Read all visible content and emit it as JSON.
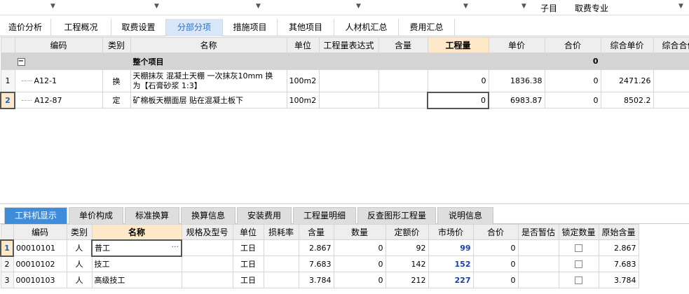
{
  "top_bar": {
    "labels": [
      "子目",
      "取费专业"
    ]
  },
  "main_tabs": [
    "造价分析",
    "工程概况",
    "取费设置",
    "分部分项",
    "措施项目",
    "其他项目",
    "人材机汇总",
    "费用汇总"
  ],
  "upper_table": {
    "columns": [
      "编码",
      "类别",
      "名称",
      "单位",
      "工程量表达式",
      "含量",
      "工程量",
      "单价",
      "合价",
      "综合单价",
      "综合合价"
    ],
    "group_row": {
      "name": "整个项目",
      "total": "0"
    },
    "rows": [
      {
        "row_num": "1",
        "code": "A12-1",
        "type": "换",
        "name_line1": "天棚抹灰 混凝土天棚 一次抹灰10mm  换",
        "name_line2": "为【石膏砂浆 1:3】",
        "unit": "100m2",
        "expr": "",
        "content": "",
        "quantity": "0",
        "unit_price": "1836.38",
        "total": "0",
        "comp_price": "2471.26"
      },
      {
        "row_num": "2",
        "code": "A12-87",
        "type": "定",
        "name_line1": "矿棉板天棚面层 贴在混凝土板下",
        "unit": "100m2",
        "expr": "",
        "content": "",
        "quantity": "0",
        "unit_price": "6983.87",
        "total": "0",
        "comp_price": "8502.2"
      }
    ]
  },
  "bottom_tabs": [
    "工料机显示",
    "单价构成",
    "标准换算",
    "换算信息",
    "安装费用",
    "工程量明细",
    "反查图形工程量",
    "说明信息"
  ],
  "lower_table": {
    "columns": [
      "编码",
      "类别",
      "名称",
      "规格及型号",
      "单位",
      "损耗率",
      "含量",
      "数量",
      "定额价",
      "市场价",
      "合价",
      "是否暂估",
      "锁定数量",
      "原始含量"
    ],
    "rows": [
      {
        "row_num": "1",
        "code": "00010101",
        "type": "人",
        "name": "普工",
        "unit": "工日",
        "content": "2.867",
        "qty": "0",
        "fixed_price": "92",
        "market_price": "99",
        "total": "0",
        "orig_content": "2.867"
      },
      {
        "row_num": "2",
        "code": "00010102",
        "type": "人",
        "name": "技工",
        "unit": "工日",
        "content": "7.683",
        "qty": "0",
        "fixed_price": "142",
        "market_price": "152",
        "total": "0",
        "orig_content": "7.683"
      },
      {
        "row_num": "3",
        "code": "00010103",
        "type": "人",
        "name": "高级技工",
        "unit": "工日",
        "content": "3.784",
        "qty": "0",
        "fixed_price": "212",
        "market_price": "227",
        "total": "0",
        "orig_content": "3.784"
      }
    ]
  },
  "colors": {
    "active_tab_bg": "#d7e7f7",
    "active_tab_text": "#2a73c8",
    "highlight_header": "#fde9c8",
    "bottom_active_tab": "#3d8ddc",
    "market_price_text": "#1b3fae"
  }
}
